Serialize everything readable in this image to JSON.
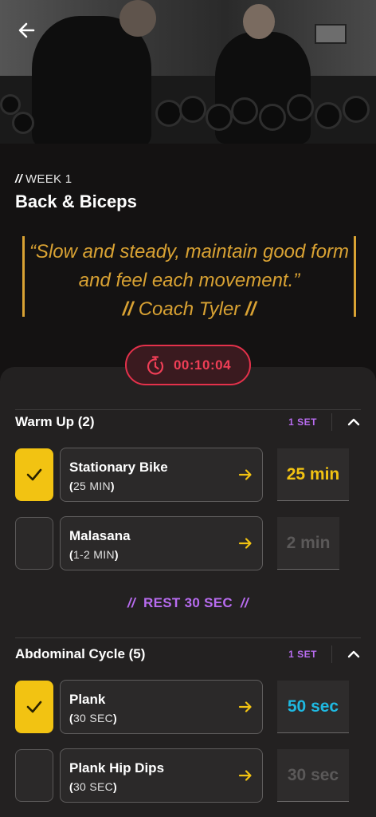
{
  "header": {
    "week_label": "WEEK 1",
    "week_prefix": "//",
    "workout_title": "Back & Biceps"
  },
  "quote": {
    "text": "“Slow and steady, maintain good form and feel each movement.”",
    "author": "Coach Tyler",
    "author_marker": "//"
  },
  "timer": {
    "value": "00:10:04"
  },
  "colors": {
    "accent_gold": "#d9a233",
    "checked_yellow": "#f2c312",
    "timer_red": "#ef3e56",
    "sets_purple": "#b86cf0",
    "value_yellow": "#f2c312",
    "value_cyan": "#1fb8e0",
    "value_muted": "#5b5959"
  },
  "sections": [
    {
      "name": "Warm Up (2)",
      "sets": "1 SET",
      "exercises": [
        {
          "name": "Stationary Bike",
          "duration_paren_open": "(",
          "duration": "25 MIN",
          "duration_paren_close": ")",
          "value": "25 min",
          "checked": true
        },
        {
          "name": "Malasana",
          "duration_paren_open": "(",
          "duration": "1-2 MIN",
          "duration_paren_close": ")",
          "value": "2 min",
          "checked": false
        }
      ]
    },
    {
      "name": "Abdominal Cycle (5)",
      "sets": "1 SET",
      "exercises": [
        {
          "name": "Plank",
          "duration_paren_open": "(",
          "duration": "30 SEC",
          "duration_paren_close": ")",
          "value": "50 sec",
          "checked": true
        },
        {
          "name": "Plank Hip Dips",
          "duration_paren_open": "(",
          "duration": "30 SEC",
          "duration_paren_close": ")",
          "value": "30 sec",
          "checked": false
        }
      ]
    }
  ],
  "rest": {
    "label": "REST 30 SEC",
    "marker": "//"
  },
  "icons": {
    "back": "arrow-left-icon",
    "timer": "stopwatch-icon",
    "check": "check-icon",
    "chevron": "chevron-up-icon",
    "exercise_arrow": "arrow-right-icon"
  }
}
